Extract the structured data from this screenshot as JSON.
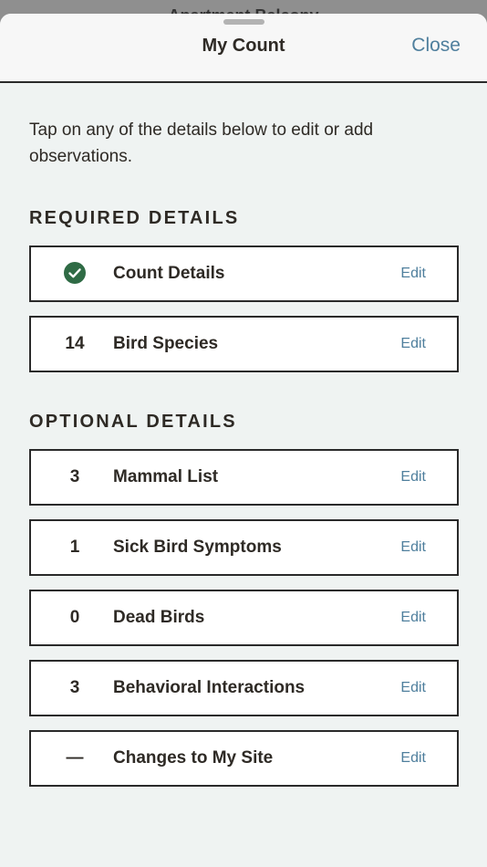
{
  "behind": {
    "title": "Apartment Balcony"
  },
  "header": {
    "title": "My Count",
    "close_label": "Close"
  },
  "intro": "Tap on any of the details below to edit or add observations.",
  "required": {
    "heading": "REQUIRED DETAILS",
    "rows": [
      {
        "status": "complete",
        "label": "Count Details",
        "edit": "Edit"
      },
      {
        "count": "14",
        "label": "Bird Species",
        "edit": "Edit"
      }
    ]
  },
  "optional": {
    "heading": "OPTIONAL DETAILS",
    "rows": [
      {
        "count": "3",
        "label": "Mammal List",
        "edit": "Edit"
      },
      {
        "count": "1",
        "label": "Sick Bird Symptoms",
        "edit": "Edit"
      },
      {
        "count": "0",
        "label": "Dead Birds",
        "edit": "Edit"
      },
      {
        "count": "3",
        "label": "Behavioral Interactions",
        "edit": "Edit"
      },
      {
        "count": "—",
        "label": "Changes to My Site",
        "edit": "Edit"
      }
    ]
  },
  "colors": {
    "accent": "#4f7f9d",
    "check": "#2f6b45",
    "text": "#2e2a25",
    "sheet_bg": "#eff3f2"
  },
  "icons": {
    "complete": "checkmark-circle-icon"
  }
}
